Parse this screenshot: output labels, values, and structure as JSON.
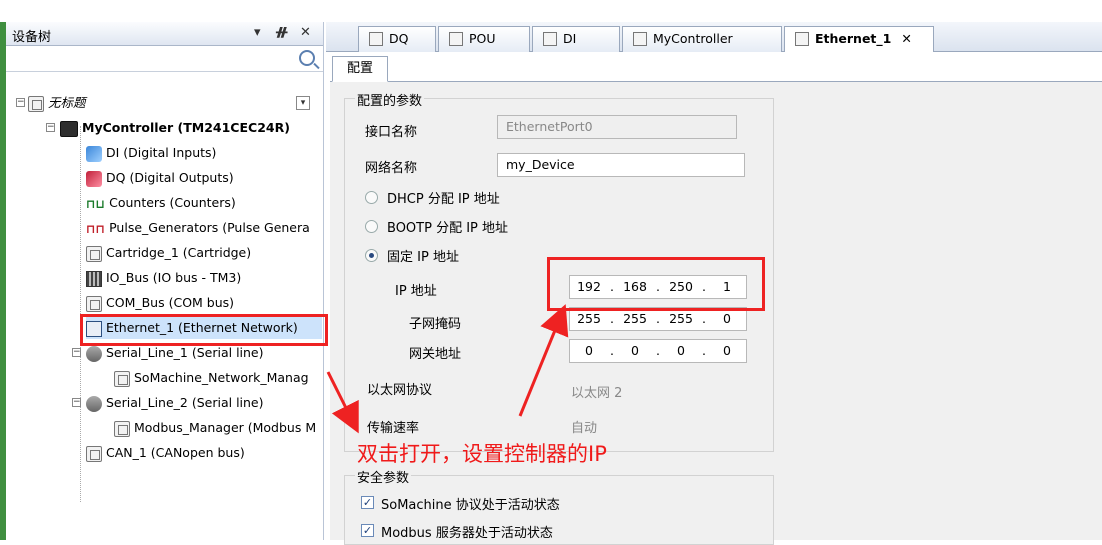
{
  "left_panel": {
    "title": "设备树",
    "controls": [
      "▾",
      "ᚌ",
      "✕"
    ],
    "root": "无标题",
    "controller": "MyController (TM241CEC24R)",
    "items": [
      {
        "label": "DI (Digital Inputs)",
        "icon": "digital-inputs-icon"
      },
      {
        "label": "DQ (Digital Outputs)",
        "icon": "digital-outputs-icon"
      },
      {
        "label": "Counters (Counters)",
        "icon": "counter-wave-icon"
      },
      {
        "label": "Pulse_Generators (Pulse Genera",
        "icon": "pulse-icon"
      },
      {
        "label": "Cartridge_1 (Cartridge)",
        "icon": "device-icon"
      },
      {
        "label": "IO_Bus (IO bus - TM3)",
        "icon": "io-bus-icon"
      },
      {
        "label": "COM_Bus (COM bus)",
        "icon": "device-icon"
      },
      {
        "label": "Ethernet_1 (Ethernet Network)",
        "icon": "ethernet-pc-icon"
      },
      {
        "label": "Serial_Line_1 (Serial line)",
        "icon": "serial-line-icon"
      },
      {
        "label": "SoMachine_Network_Manag",
        "icon": "device-icon"
      },
      {
        "label": "Serial_Line_2 (Serial line)",
        "icon": "serial-line-icon"
      },
      {
        "label": "Modbus_Manager (Modbus M",
        "icon": "device-icon"
      },
      {
        "label": "CAN_1 (CANopen bus)",
        "icon": "device-icon"
      }
    ]
  },
  "tabs": [
    {
      "label": "DQ"
    },
    {
      "label": "POU"
    },
    {
      "label": "DI"
    },
    {
      "label": "MyController"
    },
    {
      "label": "Ethernet_1",
      "close": "✕"
    }
  ],
  "subtab": "配置",
  "config": {
    "group_title": "配置的参数",
    "interface_label": "接口名称",
    "interface_value": "EthernetPort0",
    "network_label": "网络名称",
    "network_value": "my_Device",
    "dhcp_label": "DHCP 分配 IP 地址",
    "bootp_label": "BOOTP 分配 IP 地址",
    "fixed_label": "固定 IP 地址",
    "ip_label": "IP 地址",
    "ip": [
      "192",
      "168",
      "250",
      "1"
    ],
    "mask_label": "子网掩码",
    "mask": [
      "255",
      "255",
      "255",
      "0"
    ],
    "gateway_label": "网关地址",
    "gateway": [
      "0",
      "0",
      "0",
      "0"
    ],
    "protocol_label": "以太网协议",
    "protocol_value": "以太网 2",
    "speed_label": "传输速率",
    "speed_value": "自动"
  },
  "security": {
    "group_title": "安全参数",
    "somachine_label": "SoMachine 协议处于活动状态",
    "modbus_label": "Modbus 服务器处于活动状态"
  },
  "annotation": "双击打开，设置控制器的IP",
  "colors": {
    "annotation": "#ee2222",
    "selection": "#cde3fb"
  }
}
